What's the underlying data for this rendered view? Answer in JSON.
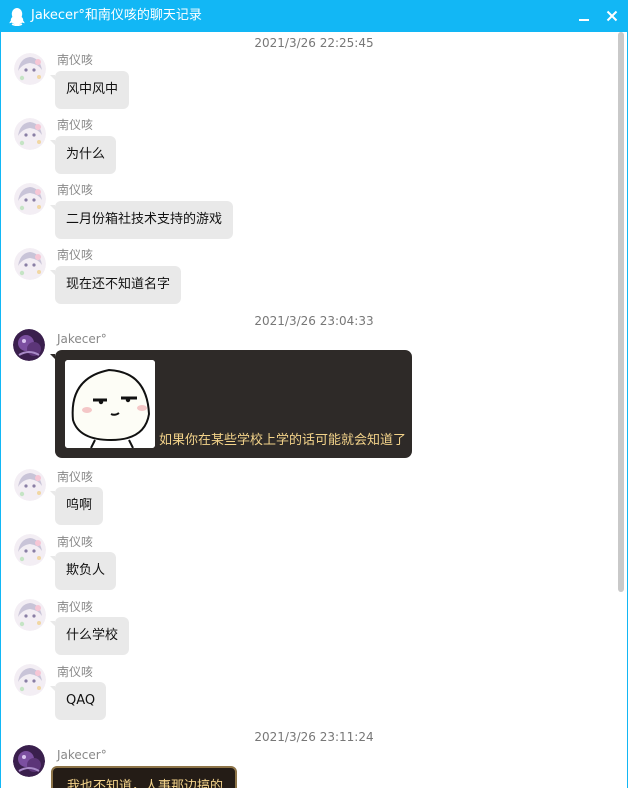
{
  "window": {
    "title": "Jakecer°和南仪咳的聊天记录",
    "accent_color": "#12b7f5",
    "icons": {
      "app": "qq-penguin-icon",
      "minimize": "minimize-icon",
      "close": "close-icon"
    }
  },
  "messages": {
    "ts1": "2021/3/26 22:25:45",
    "m1": {
      "sender": "南仪咳",
      "text": "风中风中"
    },
    "m2": {
      "sender": "南仪咳",
      "text": "为什么"
    },
    "m3": {
      "sender": "南仪咳",
      "text": "二月份箱社技术支持的游戏"
    },
    "m4": {
      "sender": "南仪咳",
      "text": "现在还不知道名字"
    },
    "ts2": "2021/3/26 23:04:33",
    "m5": {
      "sender": "Jakecer°",
      "text": "如果你在某些学校上学的话可能就会知道了",
      "sticker": "meme-face-sticker"
    },
    "m6": {
      "sender": "南仪咳",
      "text": "呜啊"
    },
    "m7": {
      "sender": "南仪咳",
      "text": "欺负人"
    },
    "m8": {
      "sender": "南仪咳",
      "text": "什么学校"
    },
    "m9": {
      "sender": "南仪咳",
      "text": "QAQ"
    },
    "ts3": "2021/3/26 23:11:24",
    "m10": {
      "sender": "Jakecer°",
      "text": "我也不知道，人事那边搞的"
    }
  }
}
